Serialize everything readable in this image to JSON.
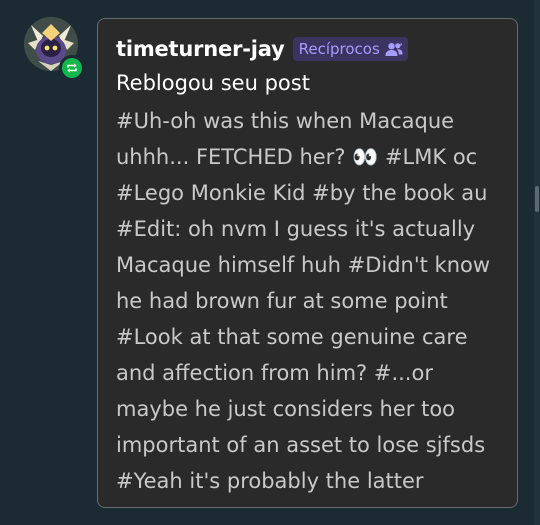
{
  "notification": {
    "username": "timeturner-jay",
    "relationship_badge": {
      "label": "Recíprocos",
      "icon": "mutuals-icon",
      "color": "#a89bff"
    },
    "avatar_badge_icon": "reblog-icon",
    "action": "Reblogou seu post",
    "tag_lines": [
      "#Uh-oh was this when Macaque",
      "uhhh... FETCHED her? 👀 #LMK oc",
      "#Lego Monkie Kid #by the book au",
      "#Edit: oh nvm I guess it's actually",
      "Macaque himself huh #Didn't know",
      "he had brown fur at some point",
      "#Look at that some genuine care",
      "and affection from him? #...or",
      "maybe he just considers her too",
      "important of an asset to lose sjfsds",
      "#Yeah it's probably the latter"
    ]
  },
  "colors": {
    "page_background": "#1c2b33",
    "card_background": "#2a2a2a",
    "reblog_green": "#12b84f",
    "badge_background": "#3b3360"
  }
}
